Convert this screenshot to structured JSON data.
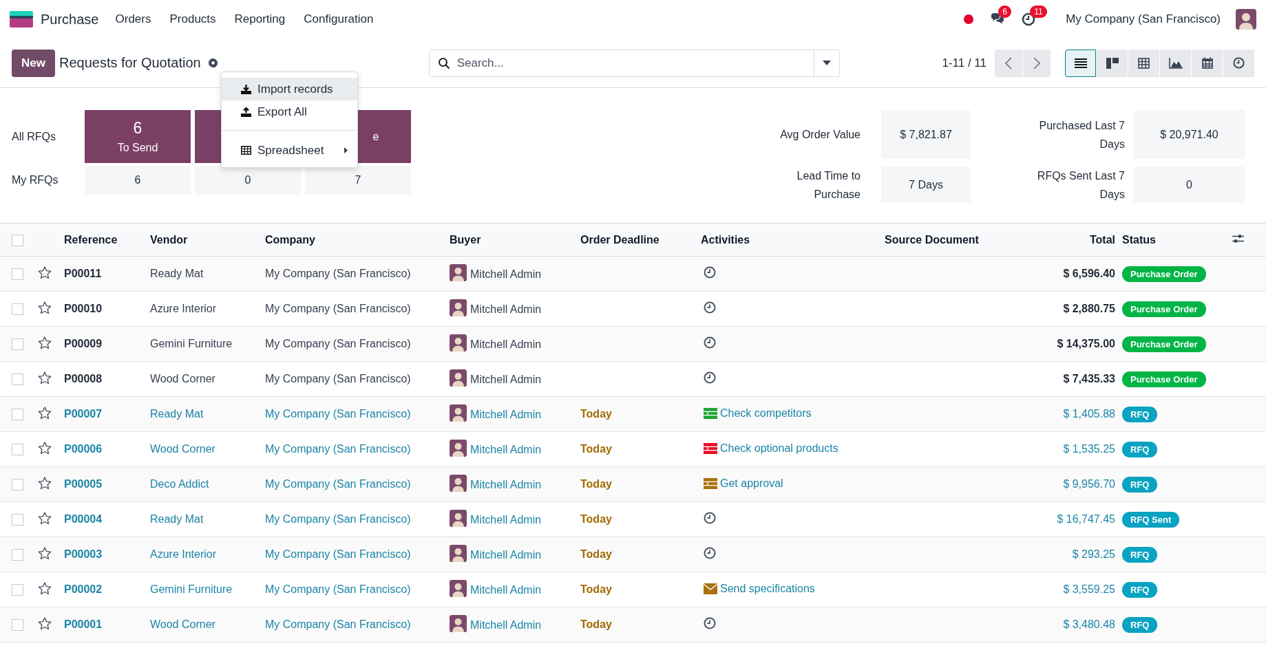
{
  "navbar": {
    "app": "Purchase",
    "menus": [
      "Orders",
      "Products",
      "Reporting",
      "Configuration"
    ],
    "messages_badge": "6",
    "activities_badge": "11",
    "company": "My Company (San Francisco)"
  },
  "control_panel": {
    "new_button": "New",
    "title": "Requests for Quotation",
    "search": {
      "placeholder": "Search..."
    },
    "pager": "1-11 / 11",
    "views": [
      {
        "kind": "list",
        "selected": true
      },
      {
        "kind": "kanban",
        "selected": false
      },
      {
        "kind": "pivot",
        "selected": false
      },
      {
        "kind": "graph",
        "selected": false
      },
      {
        "kind": "calendar",
        "selected": false
      },
      {
        "kind": "activity",
        "selected": false
      }
    ]
  },
  "actions_menu": {
    "groups": [
      [
        {
          "kind": "download",
          "label": "Import records",
          "selected": true,
          "submenu": false
        },
        {
          "kind": "upload",
          "label": "Export All",
          "selected": false,
          "submenu": false
        }
      ],
      [
        {
          "kind": "table",
          "label": "Spreadsheet",
          "selected": false,
          "submenu": true
        }
      ]
    ]
  },
  "dashboard": {
    "row_labels": [
      "All RFQs",
      "My RFQs"
    ],
    "columns": [
      {
        "tile": {
          "count": "6",
          "label": "To Send"
        },
        "my_count": "6"
      },
      {
        "my_count": "0"
      },
      {
        "tile": {
          "label": "e"
        },
        "my_count": "7"
      }
    ],
    "kpis": [
      {
        "label": "Avg Order Value",
        "value": "$ 7,821.87"
      },
      {
        "label": "Purchased Last 7 Days",
        "value": "$ 20,971.40"
      },
      {
        "label": "Lead Time to Purchase",
        "value": "7 Days"
      },
      {
        "label": "RFQs Sent Last 7 Days",
        "value": "0"
      }
    ]
  },
  "table": {
    "all_checked": false,
    "columns": [
      "Reference",
      "Vendor",
      "Company",
      "Buyer",
      "Order Deadline",
      "Activities",
      "Source Document",
      "Total",
      "Status"
    ],
    "rows": [
      {
        "checked": false,
        "starred": false,
        "reference": "P00011",
        "vendor": "Ready Mat",
        "company": "My Company (San Francisco)",
        "buyer": "Mitchell Admin",
        "activity": {
          "kind": "clock"
        },
        "total": "$ 6,596.40",
        "status": "Purchase Order",
        "confirmed": true
      },
      {
        "checked": false,
        "starred": false,
        "reference": "P00010",
        "vendor": "Azure Interior",
        "company": "My Company (San Francisco)",
        "buyer": "Mitchell Admin",
        "activity": {
          "kind": "clock"
        },
        "total": "$ 2,880.75",
        "status": "Purchase Order",
        "confirmed": true
      },
      {
        "checked": false,
        "starred": false,
        "reference": "P00009",
        "vendor": "Gemini Furniture",
        "company": "My Company (San Francisco)",
        "buyer": "Mitchell Admin",
        "activity": {
          "kind": "clock"
        },
        "total": "$ 14,375.00",
        "status": "Purchase Order",
        "confirmed": true
      },
      {
        "checked": false,
        "starred": false,
        "reference": "P00008",
        "vendor": "Wood Corner",
        "company": "My Company (San Francisco)",
        "buyer": "Mitchell Admin",
        "activity": {
          "kind": "clock"
        },
        "total": "$ 7,435.33",
        "status": "Purchase Order",
        "confirmed": true
      },
      {
        "checked": false,
        "starred": false,
        "reference": "P00007",
        "vendor": "Ready Mat",
        "company": "My Company (San Francisco)",
        "buyer": "Mitchell Admin",
        "deadline": "Today",
        "activity": {
          "kind": "todo",
          "color": "#21a336",
          "summary": "Check competitors"
        },
        "total": "$ 1,405.88",
        "status": "RFQ",
        "confirmed": false
      },
      {
        "checked": false,
        "starred": false,
        "reference": "P00006",
        "vendor": "Wood Corner",
        "company": "My Company (San Francisco)",
        "buyer": "Mitchell Admin",
        "deadline": "Today",
        "activity": {
          "kind": "todo",
          "color": "#e8102a",
          "summary": "Check optional products"
        },
        "total": "$ 1,535.25",
        "status": "RFQ",
        "confirmed": false
      },
      {
        "checked": false,
        "starred": false,
        "reference": "P00005",
        "vendor": "Deco Addict",
        "company": "My Company (San Francisco)",
        "buyer": "Mitchell Admin",
        "deadline": "Today",
        "activity": {
          "kind": "todo",
          "color": "#a8720c",
          "summary": "Get approval"
        },
        "total": "$ 9,956.70",
        "status": "RFQ",
        "confirmed": false
      },
      {
        "checked": false,
        "starred": false,
        "reference": "P00004",
        "vendor": "Ready Mat",
        "company": "My Company (San Francisco)",
        "buyer": "Mitchell Admin",
        "deadline": "Today",
        "activity": {
          "kind": "clock"
        },
        "total": "$ 16,747.45",
        "status": "RFQ Sent",
        "confirmed": false
      },
      {
        "checked": false,
        "starred": false,
        "reference": "P00003",
        "vendor": "Azure Interior",
        "company": "My Company (San Francisco)",
        "buyer": "Mitchell Admin",
        "deadline": "Today",
        "activity": {
          "kind": "clock"
        },
        "total": "$ 293.25",
        "status": "RFQ",
        "confirmed": false
      },
      {
        "checked": false,
        "starred": false,
        "reference": "P00002",
        "vendor": "Gemini Furniture",
        "company": "My Company (San Francisco)",
        "buyer": "Mitchell Admin",
        "deadline": "Today",
        "activity": {
          "kind": "email",
          "color": "#a8720c",
          "summary": "Send specifications"
        },
        "total": "$ 3,559.25",
        "status": "RFQ",
        "confirmed": false
      },
      {
        "checked": false,
        "starred": false,
        "reference": "P00001",
        "vendor": "Wood Corner",
        "company": "My Company (San Francisco)",
        "buyer": "Mitchell Admin",
        "deadline": "Today",
        "activity": {
          "kind": "clock"
        },
        "total": "$ 3,480.48",
        "status": "RFQ",
        "confirmed": false
      }
    ]
  }
}
